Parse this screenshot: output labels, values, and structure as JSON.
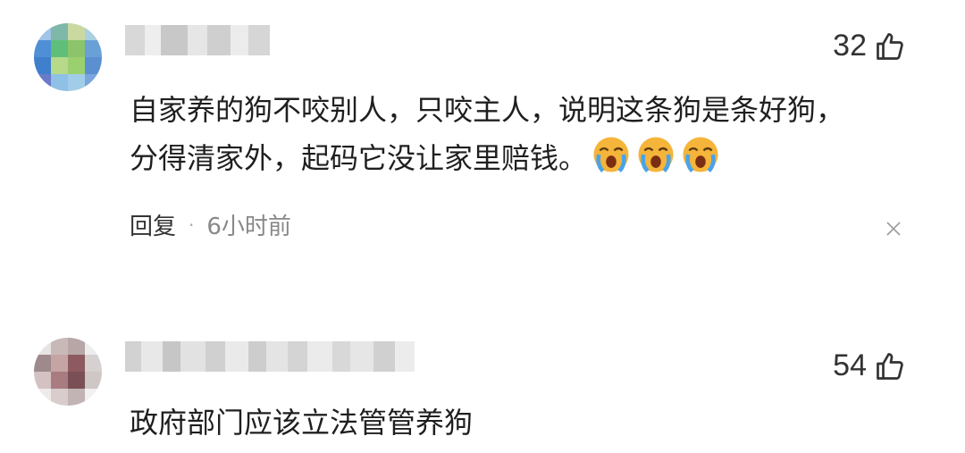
{
  "comments": [
    {
      "likes": "32",
      "text_line1": "自家养的狗不咬别人，只咬主人，说明这条狗是条好狗，",
      "text_line2": "分得清家外，起码它没让家里赔钱。",
      "reply_label": "回复",
      "separator": "·",
      "time": "6小时前",
      "emoji_icon": "crying-face-icon",
      "close_icon": "close-icon"
    },
    {
      "likes": "54",
      "text_line1": "政府部门应该立法管管养狗"
    }
  ],
  "colors": {
    "like_icon_stroke": "#333333",
    "emoji_fill": "#f5b43a",
    "tears": "#4aa3e8"
  }
}
